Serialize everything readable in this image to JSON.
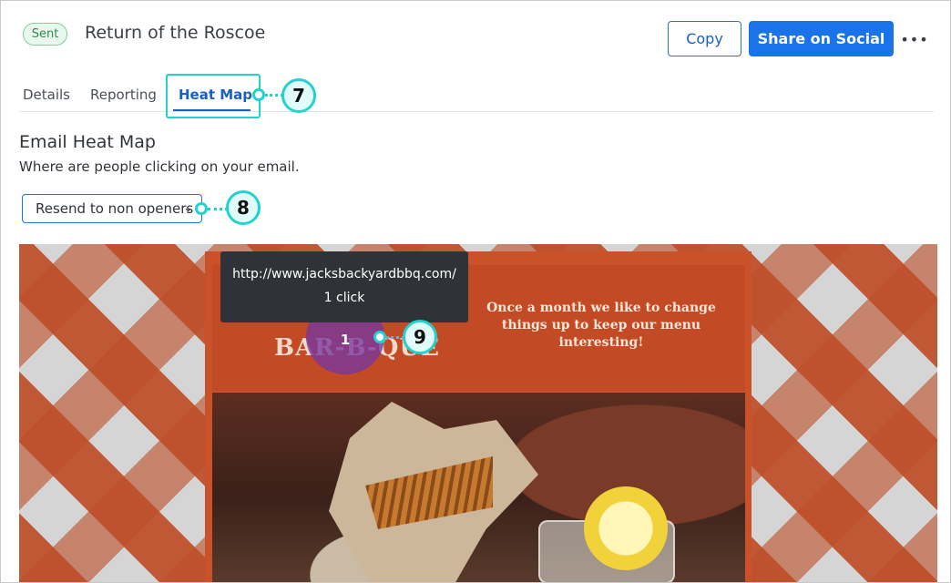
{
  "header": {
    "status_badge": "Sent",
    "title": "Return of the Roscoe",
    "copy_label": "Copy",
    "share_label": "Share on Social",
    "more_label": "•••"
  },
  "tabs": [
    {
      "label": "Details"
    },
    {
      "label": "Reporting"
    },
    {
      "label": "Heat Map",
      "active": true
    }
  ],
  "heatmap": {
    "title": "Email Heat Map",
    "subtitle": "Where are people clicking on your email.",
    "select_value": "Resend to non openers"
  },
  "email": {
    "logo_text": "BAR-B-QUE",
    "tagline": "Once a month we like to change things up to keep our menu interesting!"
  },
  "hotspot": {
    "count": "1",
    "tooltip_url": "http://www.jacksbackyardbbq.com/",
    "tooltip_clicks": "1 click"
  },
  "callouts": {
    "tab": "7",
    "select": "8",
    "hotspot": "9"
  },
  "colors": {
    "accent": "#1a73e8",
    "callout": "#22d2cc",
    "badge_green": "#2f8a4e",
    "heat_purple": "#7637a0"
  },
  "icons": {
    "more": "more-horizontal-icon",
    "select": "chevron-down-icon"
  }
}
